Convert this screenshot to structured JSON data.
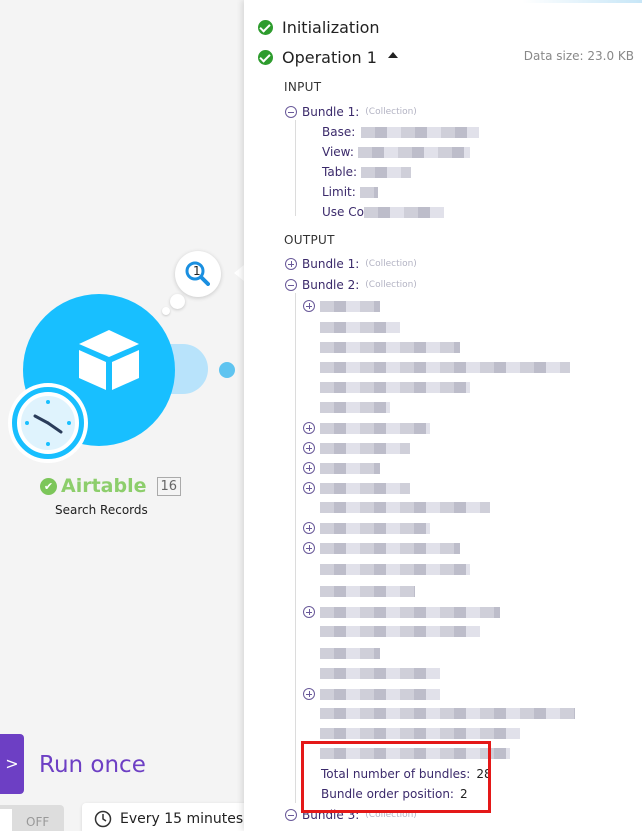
{
  "canvas": {
    "bubble_count": "1",
    "module_name": "Airtable",
    "module_badge": "16",
    "module_subtitle": "Search Records",
    "run_button_icon": ">",
    "run_label": "Run once",
    "toggle_label": "OFF",
    "schedule_text": "Every 15 minutes."
  },
  "panel": {
    "step_initialization": "Initialization",
    "step_operation": "Operation 1",
    "data_size": "Data size: 23.0 KB",
    "input_header": "INPUT",
    "output_header": "OUTPUT",
    "collection_tag": "(Collection)",
    "input_bundle": "Bundle 1:",
    "input_fields": [
      {
        "label": "Base:",
        "value": "...UXL...UIEOOX...58"
      },
      {
        "label": "View:",
        "value": ""
      },
      {
        "label": "Table:",
        "value": ""
      },
      {
        "label": "Limit:",
        "value": ""
      },
      {
        "label": "Use Co",
        "value": ""
      }
    ],
    "output_bundles": [
      "Bundle 1:",
      "Bundle 2:",
      "Bundle 3:"
    ],
    "total_label": "Total number of bundles:",
    "total_value": "28",
    "order_label": "Bundle order position:",
    "order_value": "2"
  },
  "colors": {
    "airtable_blue": "#18bfff",
    "make_purple": "#6d3fc4",
    "success_green": "#2e9c2e",
    "highlight_red": "#e41818"
  }
}
